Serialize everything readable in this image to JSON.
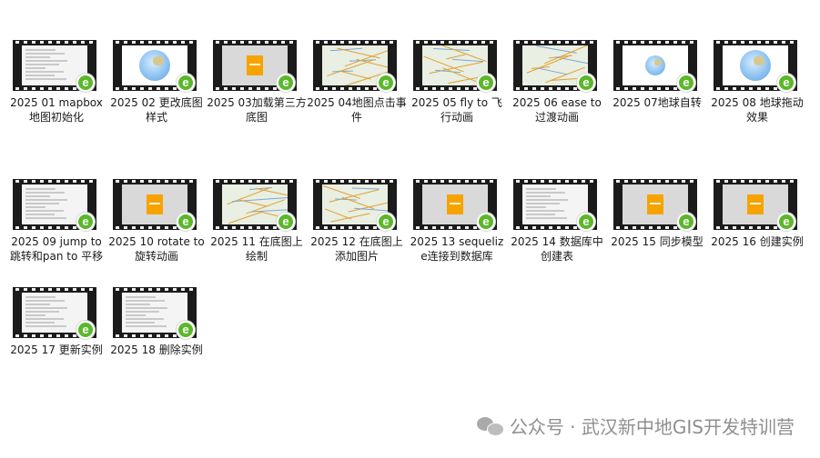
{
  "items": [
    {
      "label": "2025 01 mapbox地图初始化",
      "preview": "doc"
    },
    {
      "label": "2025 02 更改底图样式",
      "preview": "globe"
    },
    {
      "label": "2025 03加载第三方底图",
      "preview": "logo"
    },
    {
      "label": "2025 04地图点击事件",
      "preview": "map"
    },
    {
      "label": "2025 05 fly to 飞行动画",
      "preview": "map"
    },
    {
      "label": "2025 06 ease to 过渡动画",
      "preview": "map"
    },
    {
      "label": "2025 07地球自转",
      "preview": "globe"
    },
    {
      "label": "2025 08 地球拖动效果",
      "preview": "globe"
    },
    {
      "label": "2025 09 jump to跳转和pan to 平移",
      "preview": "doc"
    },
    {
      "label": "2025 10 rotate to 旋转动画",
      "preview": "logo"
    },
    {
      "label": "2025 11 在底图上绘制",
      "preview": "map"
    },
    {
      "label": "2025 12 在底图上添加图片",
      "preview": "map"
    },
    {
      "label": "2025 13 sequelize连接到数据库",
      "preview": "logo"
    },
    {
      "label": "2025 14 数据库中创建表",
      "preview": "doc"
    },
    {
      "label": "2025 15 同步模型",
      "preview": "logo"
    },
    {
      "label": "2025 16 创建实例",
      "preview": "logo"
    },
    {
      "label": "2025 17 更新实例",
      "preview": "doc"
    },
    {
      "label": "2025 18 删除实例",
      "preview": "doc"
    }
  ],
  "badge_letter": "e",
  "footer": {
    "text": "公众号 · 武汉新中地GIS开发特训营",
    "icon": "wechat-icon"
  },
  "colors": {
    "film": "#1b1b1b",
    "badge": "#5bb82a",
    "logo": "#f6a300",
    "footer_text": "#8f8f8f"
  }
}
